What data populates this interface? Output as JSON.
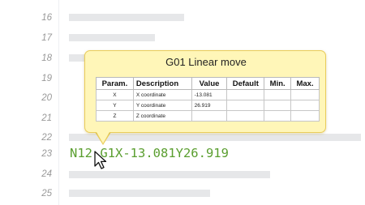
{
  "editor": {
    "line_numbers": [
      "16",
      "17",
      "18",
      "19",
      "20",
      "21",
      "22",
      "23",
      "24",
      "25"
    ],
    "code_line": {
      "line": "23",
      "text": "N12 G1X-13.081Y26.919"
    }
  },
  "tooltip": {
    "title": "G01 Linear move",
    "columns": [
      "Param.",
      "Description",
      "Value",
      "Default",
      "Min.",
      "Max."
    ],
    "rows": [
      [
        "X",
        "X coordinate",
        "-13.081",
        "",
        "",
        ""
      ],
      [
        "Y",
        "Y coordinate",
        "26.919",
        "",
        "",
        ""
      ],
      [
        "Z",
        "Z coordinate",
        "",
        "",
        "",
        ""
      ]
    ]
  },
  "colors": {
    "code_text": "#5a9e2f",
    "tooltip_background": "#fff6b8",
    "tooltip_border": "#e9cc5a",
    "placeholder_bar": "#e6e7e9"
  },
  "icons": {
    "cursor": "arrow-pointer-icon"
  }
}
